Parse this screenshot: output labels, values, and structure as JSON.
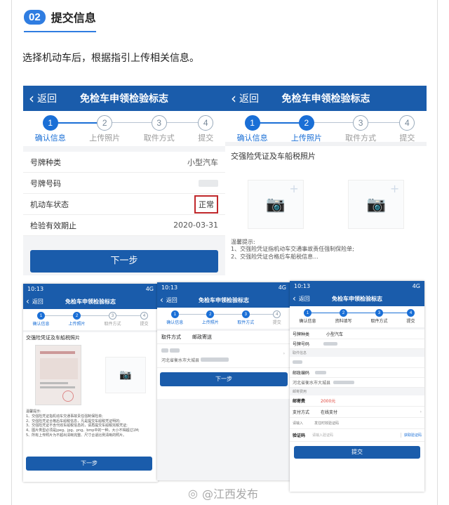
{
  "section": {
    "number": "02",
    "title": "提交信息"
  },
  "intro": "选择机动车后，根据指引上传相关信息。",
  "nav": {
    "back": "返回",
    "title": "免检车申领检验标志"
  },
  "steps": [
    {
      "num": "1",
      "label": "确认信息"
    },
    {
      "num": "2",
      "label": "上传照片"
    },
    {
      "num": "3",
      "label": "取件方式"
    },
    {
      "num": "4",
      "label": "提交"
    }
  ],
  "steps_alt": [
    {
      "num": "1",
      "label": "确认信息"
    },
    {
      "num": "2",
      "label": "资料填写"
    },
    {
      "num": "3",
      "label": "取件方式"
    },
    {
      "num": "4",
      "label": "提交"
    }
  ],
  "confirm": {
    "rows": [
      {
        "key": "号牌种类",
        "value": "小型汽车"
      },
      {
        "key": "号牌号码",
        "value": ""
      },
      {
        "key": "机动车状态",
        "value": "正常"
      },
      {
        "key": "检验有效期止",
        "value": "2020-03-31"
      }
    ],
    "next": "下一步"
  },
  "upload": {
    "heading": "交强险凭证及车船税照片",
    "tips_title": "温馨提示:",
    "tips": [
      "1、交强险凭证指机动车交通事故责任强制保险单;",
      "2、交强险凭证合格后车船税信息..."
    ]
  },
  "phone3": {
    "time": "10:13",
    "signal": "4G",
    "heading": "交强险凭证及车船税照片",
    "tips_title": "温馨提示:",
    "tips": [
      "1、交强险凭证指机动车交通事故责任强制保险单;",
      "2、交强险凭证合格后车船税信息，凡是提交车船税凭证明的;",
      "3、交强险凭证不含代收车船税信息的，请再提交车船税完税凭证;",
      "4、图片类型必须是jpeg、jpg、png、bmp中的一种，大小不得超过1M;",
      "5、所有上传照片为不超出清晰完整、尺寸合适比例清晰的照片。"
    ],
    "next": "下一步"
  },
  "phone4": {
    "time": "10:13",
    "signal": "4G",
    "tabs": [
      "取件方式",
      "邮政寄送"
    ],
    "address": "河北省衡水市大城县",
    "next": "下一步"
  },
  "phone5": {
    "time": "10:13",
    "signal": "4G",
    "rows": [
      {
        "key": "号牌种类",
        "value": "小型汽车"
      },
      {
        "key": "号牌号码",
        "value": ""
      }
    ],
    "sec_receiver": "取件信息",
    "postcode_label": "邮政编码",
    "address": "河北省衡水市大城县",
    "sec_fee": "邮寄费用",
    "fee_label": "邮寄费",
    "fee_value": "2000元",
    "pay_label": "支付方式",
    "pay_value": "在线支付",
    "contact_label": "请输入",
    "contact_hint": "发往时效验证码",
    "code_label": "验证码",
    "code_placeholder": "请输入验证码",
    "code_btn": "获取验证码",
    "submit": "提交"
  },
  "watermark": "@江西发布",
  "colors": {
    "accent": "#1a5cab",
    "step_active": "#1a6fd6",
    "highlight": "#c0282b",
    "fee": "#e0463c"
  }
}
